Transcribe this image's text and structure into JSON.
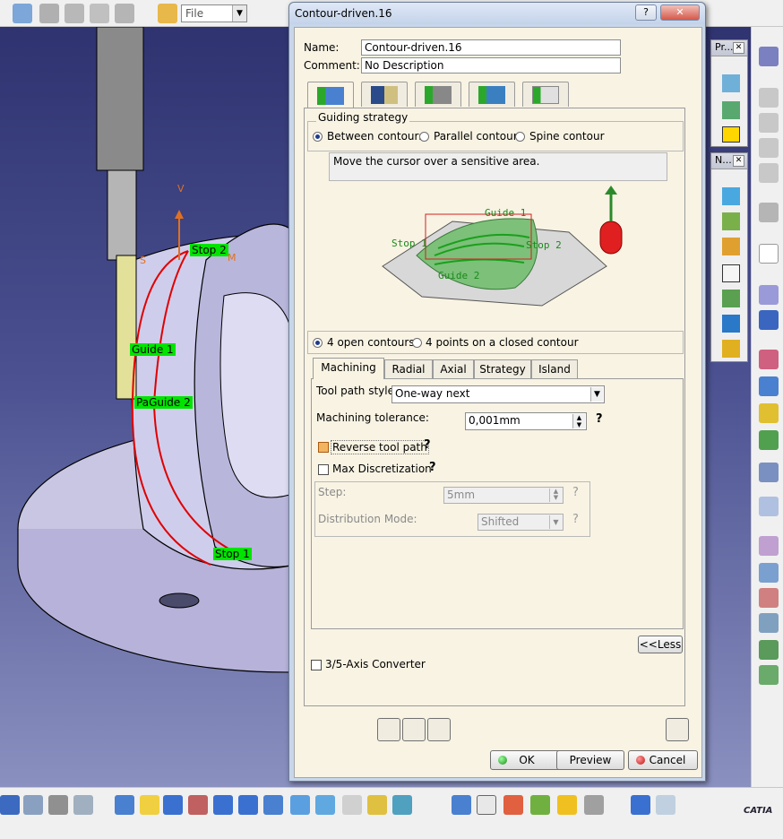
{
  "colors": {
    "accent": "#1d3b8a",
    "title_bar": "#c8d6ea",
    "dialog_bg": "#f8f3e3",
    "highlight_label": "#00e400"
  },
  "toolbar": {
    "file_combo_value": "File"
  },
  "viewport": {
    "labels": {
      "stop2": "Stop 2",
      "stop1": "Stop 1",
      "guide1": "Guide 1",
      "guide2": "Guide 2",
      "part_prefix": "Pa",
      "v": "V",
      "m": "M",
      "s": "S"
    }
  },
  "palettes": {
    "pr_title": "Pr...",
    "n_title": "N..."
  },
  "dialog": {
    "title": "Contour-driven.16",
    "help_button": "?",
    "close_button": "✕",
    "name_label": "Name:",
    "name_value": "Contour-driven.16",
    "comment_label": "Comment:",
    "comment_value": "No Description",
    "icon_tabs": [
      "strategy-tab-icon",
      "geometry-tab-icon",
      "tool-tab-icon",
      "feeds-speeds-tab-icon",
      "macros-tab-icon"
    ],
    "guiding_strategy": {
      "label": "Guiding strategy",
      "options": [
        "Between contours",
        "Parallel contour",
        "Spine contour"
      ],
      "selected": "Between contours"
    },
    "info_text": "Move the cursor over a sensitive area.",
    "diagram_labels": {
      "guide1": "Guide 1",
      "guide2": "Guide 2",
      "stop1": "Stop 1",
      "stop2": "Stop 2"
    },
    "contour_mode": {
      "options": [
        "4 open contours",
        "4 points on a closed contour"
      ],
      "selected": "4 open contours"
    },
    "tabs": [
      "Machining",
      "Radial",
      "Axial",
      "Strategy",
      "Island"
    ],
    "active_tab": "Machining",
    "machining": {
      "tool_path_style_label": "Tool path style:",
      "tool_path_style_value": "One-way next",
      "tolerance_label": "Machining tolerance:",
      "tolerance_value": "0,001mm",
      "reverse_label": "Reverse tool path",
      "reverse_checked": true,
      "max_disc_label": "Max Discretization",
      "max_disc_checked": false,
      "step_label": "Step:",
      "step_value": "5mm",
      "distribution_label": "Distribution Mode:",
      "distribution_value": "Shifted",
      "help_mark": "?"
    },
    "less_button": "<<Less",
    "converter_label": "3/5-Axis Converter",
    "converter_checked": false,
    "ok_label": "OK",
    "preview_label": "Preview",
    "cancel_label": "Cancel"
  },
  "branding": {
    "catia_logo_text": "CATIA"
  }
}
